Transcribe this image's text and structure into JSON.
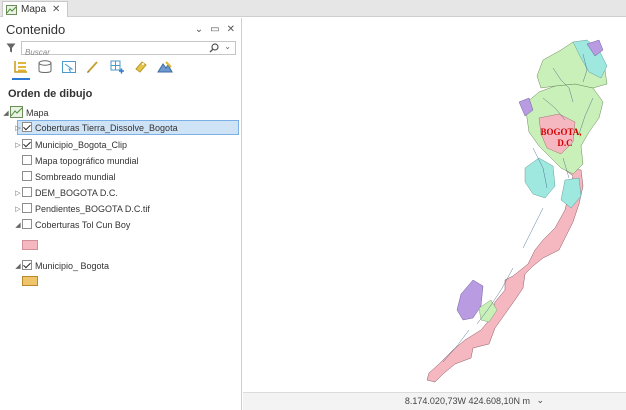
{
  "tab": {
    "label": "Mapa",
    "close": "✕"
  },
  "pane": {
    "title": "Contenido",
    "controls": [
      "⌄",
      "▭",
      "✕"
    ],
    "search_placeholder": "Buscar",
    "section_title": "Orden de dibujo",
    "toolbar_icons": [
      "list-by-drawing-order-icon",
      "list-by-source-icon",
      "list-by-selection-icon",
      "list-by-editing-icon",
      "list-by-snapping-icon",
      "list-by-labeling-icon",
      "list-by-perspective-icon"
    ]
  },
  "tree": {
    "map_label": "Mapa",
    "layers": [
      {
        "label": "Coberturas Tierra_Dissolve_Bogota",
        "checked": true,
        "expandable": true,
        "expanded": false,
        "selected": true
      },
      {
        "label": "Municipio_Bogota_Clip",
        "checked": true,
        "expandable": true,
        "expanded": false,
        "selected": false
      },
      {
        "label": "Mapa topográfico mundial",
        "checked": false,
        "expandable": false,
        "expanded": false,
        "selected": false
      },
      {
        "label": "Sombreado mundial",
        "checked": false,
        "expandable": false,
        "expanded": false,
        "selected": false
      },
      {
        "label": "DEM_BOGOTA D.C.",
        "checked": false,
        "expandable": true,
        "expanded": false,
        "selected": false
      },
      {
        "label": "Pendientes_BOGOTA D.C.tif",
        "checked": false,
        "expandable": true,
        "expanded": false,
        "selected": false
      },
      {
        "label": "Coberturas Tol Cun Boy",
        "checked": false,
        "expandable": true,
        "expanded": true,
        "selected": false,
        "swatch": "#f5b8c0"
      },
      {
        "label": "Municipio_ Bogota",
        "checked": true,
        "expandable": true,
        "expanded": true,
        "selected": false,
        "swatch": "#f0c46a"
      }
    ]
  },
  "map": {
    "label_line1": "BOGOTA,",
    "label_line2": "D.C",
    "colors": {
      "pink": "#f5b8c0",
      "green": "#c9f0b8",
      "cyan": "#9fe8e0",
      "purple": "#b89be0",
      "label": "#d30000"
    }
  },
  "status": {
    "coordinates": "8.174.020,73W 424.608,10N m",
    "chevron": "⌄"
  }
}
